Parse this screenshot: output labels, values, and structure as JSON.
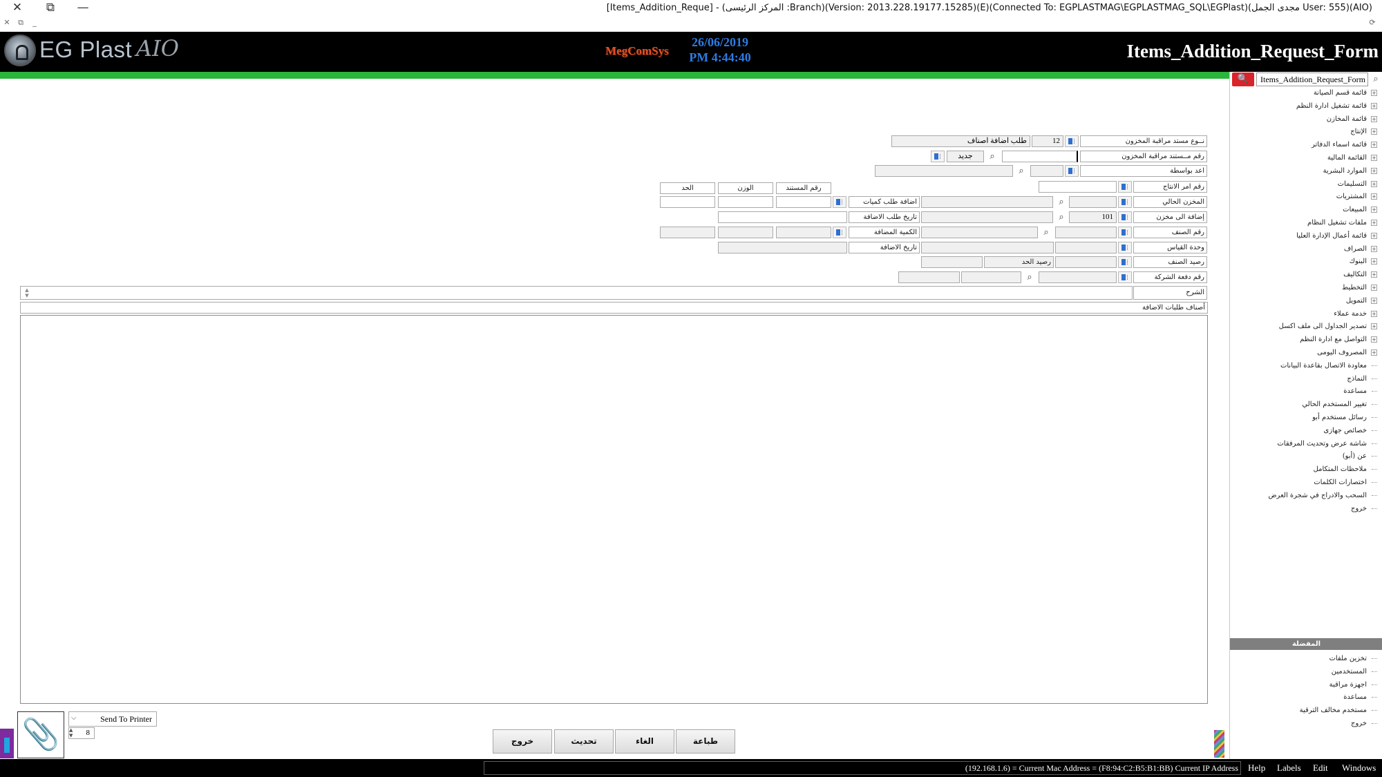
{
  "window": {
    "title": "[Items_Addition_Reque] - (المركز الرئيسى :Branch)(Version: 2013.228.19177.15285)(E)(Connected To: EGPLASTMAG\\EGPLASTMAG_SQL\\EGPlast)(مجدى الجمل User: 555)(AIO)"
  },
  "header": {
    "app_name": "EG Plast",
    "app_tag": "AIO",
    "company_logo": "MegComSys",
    "date": "26/06/2019",
    "time": "PM 4:44:40",
    "form_title": "Items_Addition_Request_Form"
  },
  "form": {
    "doc_type_label": "نــوع مستد مراقبة المخزون",
    "doc_type_code": "12",
    "doc_type_name": "طلب اضافة اصناف",
    "doc_no_label": "رقم مــستند مراقبة المخزون",
    "doc_no_value": "",
    "new_label": "جديد",
    "prepared_by_label": "اعد بواسطة",
    "production_order_label": "رقم امر الانتاج",
    "current_store_label": "المخزن الحالي",
    "add_to_store_label": "إضافة الى مخزن",
    "add_to_store_code": "101",
    "item_no_label": "رقم الصنف",
    "unit_label": "وحدة القياس",
    "item_balance_label": "رصيد الصنف",
    "limit_balance_label": "رصيد الحد",
    "company_batch_label": "رقم دفعة الشركة",
    "notes_label": "الشرح",
    "qty_request_label": "اضافة طلب كميات",
    "request_date_label": "تاريخ طلب الاضافة",
    "added_qty_label": "الكمية المضافة",
    "addition_date_label": "تاريخ الاضافة",
    "col_doc_no": "رقم المستند",
    "col_weight": "الوزن",
    "col_limit": "الحد",
    "grid_caption": "أصناف طلبات الاضافة"
  },
  "bottom": {
    "printer_option": "Send To Printer",
    "copies": "8",
    "print_btn": "طباعة",
    "cancel_btn": "الغاء",
    "update_btn": "تحديث",
    "exit_btn": "خروج"
  },
  "sidebar": {
    "search_value": "Items_Addition_Request_Form",
    "tree": [
      {
        "label": "قائمة قسم الصيانة",
        "expandable": true
      },
      {
        "label": "قائمة تشغيل ادارة النظم",
        "expandable": true
      },
      {
        "label": "قائمة المخازن",
        "expandable": true
      },
      {
        "label": "الإنتاج",
        "expandable": true
      },
      {
        "label": "قائمة اسماء الدفاتر",
        "expandable": true
      },
      {
        "label": "القائمة المالية",
        "expandable": true
      },
      {
        "label": "الموارد البشرية",
        "expandable": true
      },
      {
        "label": "التسليمات",
        "expandable": true
      },
      {
        "label": "المشتريات",
        "expandable": true
      },
      {
        "label": "المبيعات",
        "expandable": true
      },
      {
        "label": "ملفات تشغيل النظام",
        "expandable": true
      },
      {
        "label": "قائمة أعمال الإدارة العليا",
        "expandable": true
      },
      {
        "label": "الصراف",
        "expandable": true
      },
      {
        "label": "البنوك",
        "expandable": true
      },
      {
        "label": "التكاليف",
        "expandable": true
      },
      {
        "label": "التخطيط",
        "expandable": true
      },
      {
        "label": "التمويل",
        "expandable": true
      },
      {
        "label": "خدمة عملاء",
        "expandable": true
      },
      {
        "label": "تصدير الجداول الى ملف اكسل",
        "expandable": true
      },
      {
        "label": "التواصل مع ادارة النظم",
        "expandable": true
      },
      {
        "label": "المصروف اليومى",
        "expandable": true
      },
      {
        "label": "معاودة الاتصال بقاعدة البيانات",
        "expandable": false
      },
      {
        "label": "النماذج",
        "expandable": false
      },
      {
        "label": "مساعدة",
        "expandable": false
      },
      {
        "label": "تغيير المستخدم الحالي",
        "expandable": false
      },
      {
        "label": "رسائل مستخدم أبو",
        "expandable": false
      },
      {
        "label": "خصائص جهازى",
        "expandable": false
      },
      {
        "label": "شاشة عرض وتحديث المرفقات",
        "expandable": false
      },
      {
        "label": "عن (أبو)",
        "expandable": false
      },
      {
        "label": "ملاحظات المتكامل",
        "expandable": false
      },
      {
        "label": "اختصارات الكلمات",
        "expandable": false
      },
      {
        "label": "السحب والادراج في شجرة العرض",
        "expandable": false
      },
      {
        "label": "خروج",
        "expandable": false
      }
    ],
    "favorites_header": "المفضلة",
    "favorites": [
      "تخزين ملفات",
      "المستخدمين",
      "اجهزة مراقبة",
      "مساعدة",
      "مستخدم مخالف الترقية",
      "خروج"
    ]
  },
  "statusbar": {
    "message": "(192.168.1.6) = Current Mac Address = (F8:94:C2:B5:B1:BB) Current IP Address",
    "menu": [
      "Help",
      "Labels",
      "Edit",
      "Windows"
    ]
  },
  "colors": {
    "header_bg": "#000000",
    "accent_green": "#2bb53a",
    "header_date": "#2d7be3",
    "search_red": "#d8242a"
  },
  "icons": {
    "close": "close-icon",
    "restore": "restore-icon",
    "minimize": "minimize-icon",
    "search": "magnifier-icon",
    "attachment": "paperclip-icon",
    "picker": "lookup-icon"
  }
}
